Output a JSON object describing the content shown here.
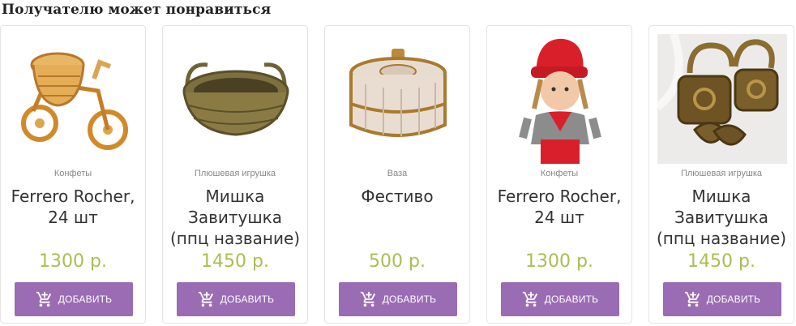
{
  "section": {
    "title": "Получателю может понравиться"
  },
  "products": [
    {
      "image": "wicker-bicycle-basket",
      "category": "Конфеты",
      "name": "Ferrero Rocher, 24 шт",
      "price": "1300 р.",
      "button": "ДОБАВИТЬ",
      "button_icon": "add-to-cart-icon"
    },
    {
      "image": "wicker-oval-basket",
      "category": "Плюшевая игрушка",
      "name": "Мишка Завитушка (ппц название)",
      "price": "1450 р.",
      "button": "ДОБАВИТЬ",
      "button_icon": "add-to-cart-icon"
    },
    {
      "image": "mother-of-pearl-box",
      "category": "Ваза",
      "name": "Фестиво",
      "price": "500 р.",
      "button": "ДОБАВИТЬ",
      "button_icon": "add-to-cart-icon"
    },
    {
      "image": "red-hat-doll",
      "category": "Конфеты",
      "name": "Ferrero Rocher, 24 шт",
      "price": "1300 р.",
      "button": "ДОБАВИТЬ",
      "button_icon": "add-to-cart-icon"
    },
    {
      "image": "bronze-lock-keychains",
      "category": "Плюшевая игрушка",
      "name": "Мишка Завитушка (ппц название)",
      "price": "1450 р.",
      "button": "ДОБАВИТЬ",
      "button_icon": "add-to-cart-icon"
    }
  ],
  "colors": {
    "price": "#a7bf54",
    "button": "#9a6cb4",
    "border": "#e4e4e4"
  }
}
